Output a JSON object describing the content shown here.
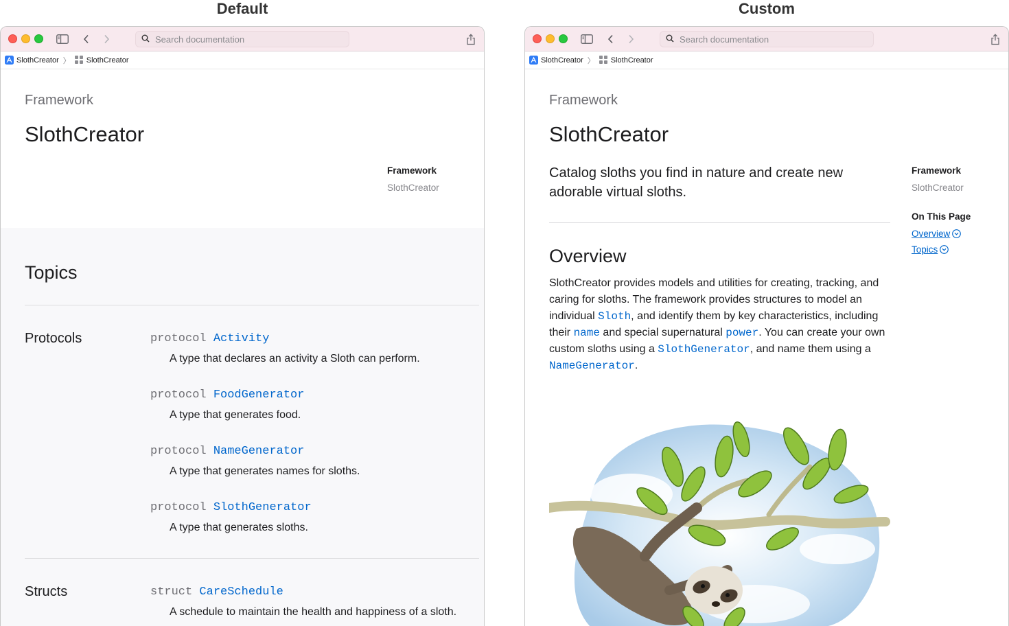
{
  "captions": {
    "left": "Default",
    "right": "Custom"
  },
  "browser": {
    "search_placeholder": "Search documentation",
    "breadcrumb_root": "SlothCreator",
    "breadcrumb_current": "SlothCreator"
  },
  "page": {
    "eyebrow": "Framework",
    "title": "SlothCreator",
    "meta_heading": "Framework",
    "meta_value": "SlothCreator"
  },
  "default_page": {
    "topics_heading": "Topics",
    "groups": [
      {
        "heading": "Protocols",
        "items": [
          {
            "keyword": "protocol",
            "name": "Activity",
            "abstract": "A type that declares an activity a Sloth can perform."
          },
          {
            "keyword": "protocol",
            "name": "FoodGenerator",
            "abstract": "A type that generates food."
          },
          {
            "keyword": "protocol",
            "name": "NameGenerator",
            "abstract": "A type that generates names for sloths."
          },
          {
            "keyword": "protocol",
            "name": "SlothGenerator",
            "abstract": "A type that generates sloths."
          }
        ]
      },
      {
        "heading": "Structs",
        "items": [
          {
            "keyword": "struct",
            "name": "CareSchedule",
            "abstract": "A schedule to maintain the health and happiness of a sloth."
          }
        ]
      }
    ]
  },
  "custom_page": {
    "intro": "Catalog sloths you find in nature and create new adorable virtual sloths.",
    "on_this_page_heading": "On This Page",
    "on_this_page_links": [
      "Overview",
      "Topics"
    ],
    "overview_heading": "Overview",
    "overview": {
      "t1": "SlothCreator provides models and utilities for creating, tracking, and caring for sloths. The framework provides structures to model an individual ",
      "c1": "Sloth",
      "t2": ", and identify them by key characteristics, including their ",
      "c2": "name",
      "t3": " and special supernatural ",
      "c3": "power",
      "t4": ". You can create your own custom sloths using a ",
      "c4": "SlothGenerator",
      "t5": ", and name them using a ",
      "c5": "NameGenerator",
      "t6": "."
    }
  },
  "colors": {
    "toolbar": "#f8e9ee",
    "link": "#0066cc",
    "topics_bg": "#f8f8fa"
  },
  "icons": [
    "sidebar-toggle-icon",
    "back-chevron-icon",
    "forward-chevron-icon",
    "search-icon",
    "share-icon",
    "app-icon",
    "framework-grid-icon",
    "chevron-circle-icon"
  ]
}
